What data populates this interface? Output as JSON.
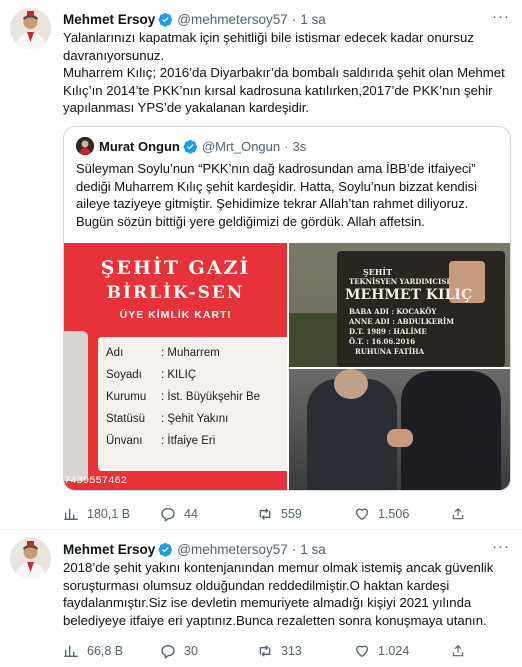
{
  "tweets": [
    {
      "author": {
        "name": "Mehmet Ersoy",
        "handle": "@mehmetersoy57",
        "time": "1 sa"
      },
      "paragraphs": [
        "Yalanlarınızı kapatmak için şehitliği bile istismar edecek kadar onursuz davranıyorsunuz.",
        "Muharrem Kılıç; 2016’da Diyarbakır’da bombalı saldırıda şehit olan Mehmet Kılıç’ın 2014’te PKK’nın kırsal kadrosuna katılırken,2017’de PKK’nın şehir yapılanması YPS’de yakalanan kardeşidir."
      ],
      "quote": {
        "author": {
          "name": "Murat Ongun",
          "handle": "@Mrt_Ongun",
          "time": "3s"
        },
        "text": "Süleyman Soylu’nun “PKK’nın dağ kadrosundan ama İBB’de itfaiyeci” dediği Muharrem Kılıç şehit kardeşidir. Hatta, Soylu’nun bizzat kendisi aileye taziyeye gitmiştir. Şehidimize tekrar Allah’tan rahmet diliyoruz. Bugün sözün bittiği yere geldiğimizi de gördük. Allah affetsin.",
        "card": {
          "title1": "ŞEHİT GAZİ",
          "title2": "BİRLİK-SEN",
          "subtitle": "ÜYE KİMLİK KARTI",
          "rows": [
            {
              "label": "Adı",
              "value": ": Muharrem"
            },
            {
              "label": "Soyadı",
              "value": ": KILIÇ"
            },
            {
              "label": "Kurumu",
              "value": ": İst. Büyükşehir Be"
            },
            {
              "label": "Statüsü",
              "value": ": Şehit Yakını"
            },
            {
              "label": "Ünvanı",
              "value": ": İtfaiye Eri"
            }
          ],
          "number": "7439557462"
        },
        "gravestone": {
          "line1": "ŞEHİT",
          "line2": "TEKNİSYEN YARDIMCISI",
          "line3": "MEHMET KILIÇ",
          "line4": "BABA ADI : KOCAKÖY",
          "line5": "ANNE ADI : ABDULKERİM",
          "line6": "D.T. 1989 : HALİME",
          "line7": "Ö.T. : 16.06.2016",
          "line8": "RUHUNA FATİHA"
        }
      },
      "stats": {
        "views": "180,1 B",
        "replies": "44",
        "retweets": "559",
        "likes": "1.506"
      }
    },
    {
      "author": {
        "name": "Mehmet Ersoy",
        "handle": "@mehmetersoy57",
        "time": "1 sa"
      },
      "paragraphs": [
        "2018’de şehit yakını kontenjanından memur olmak istemiş ancak güvenlik soruşturması olumsuz olduğundan reddedilmiştir.O haktan kardeşi faydalanmıştır.Siz ise devletin memuriyete almadığı kişiyi 2021 yılında belediyeye itfaiye eri yaptınız.Bunca rezaletten sonra konuşmaya utanın."
      ],
      "stats": {
        "views": "66,8 B",
        "replies": "30",
        "retweets": "313",
        "likes": "1.024"
      }
    }
  ],
  "colors": {
    "verified": "#1d9bf0",
    "text": "#0f1419",
    "muted": "#536471",
    "border": "#cfd9de",
    "card_red": "#e8323a"
  },
  "icons": [
    "views-icon",
    "reply-icon",
    "retweet-icon",
    "like-icon",
    "share-icon",
    "verified-badge-icon",
    "more-icon"
  ]
}
